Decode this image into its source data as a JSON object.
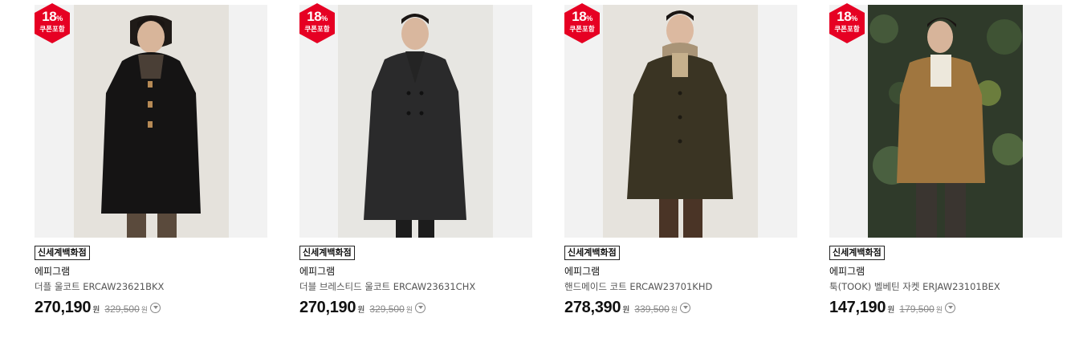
{
  "colors": {
    "badge": "#e60023",
    "badge_text": "#ffffff",
    "price": "#111111",
    "original_price": "#888888"
  },
  "currency_unit": "원",
  "products": [
    {
      "discount": "18",
      "discount_unit": "%",
      "coupon_label": "쿠폰포함",
      "store": "신세계백화점",
      "brand": "에피그램",
      "name": "더플 울코트 ERCAW23621BKX",
      "price": "270,190",
      "original_price": "329,500",
      "image": "man-in-black-duffle-coat"
    },
    {
      "discount": "18",
      "discount_unit": "%",
      "coupon_label": "쿠폰포함",
      "store": "신세계백화점",
      "brand": "에피그램",
      "name": "더블 브레스티드 울코트 ERCAW23631CHX",
      "price": "270,190",
      "original_price": "329,500",
      "image": "man-in-charcoal-double-breasted-coat"
    },
    {
      "discount": "18",
      "discount_unit": "%",
      "coupon_label": "쿠폰포함",
      "store": "신세계백화점",
      "brand": "에피그램",
      "name": "핸드메이드 코트 ERCAW23701KHD",
      "price": "278,390",
      "original_price": "339,500",
      "image": "man-in-khaki-handmade-coat"
    },
    {
      "discount": "18",
      "discount_unit": "%",
      "coupon_label": "쿠폰포함",
      "store": "신세계백화점",
      "brand": "에피그램",
      "name": "툭(TOOK) 벨베틴 자켓 ERJAW23101BEX",
      "price": "147,190",
      "original_price": "179,500",
      "image": "man-in-brown-velveteen-jacket-ivy-background"
    }
  ]
}
